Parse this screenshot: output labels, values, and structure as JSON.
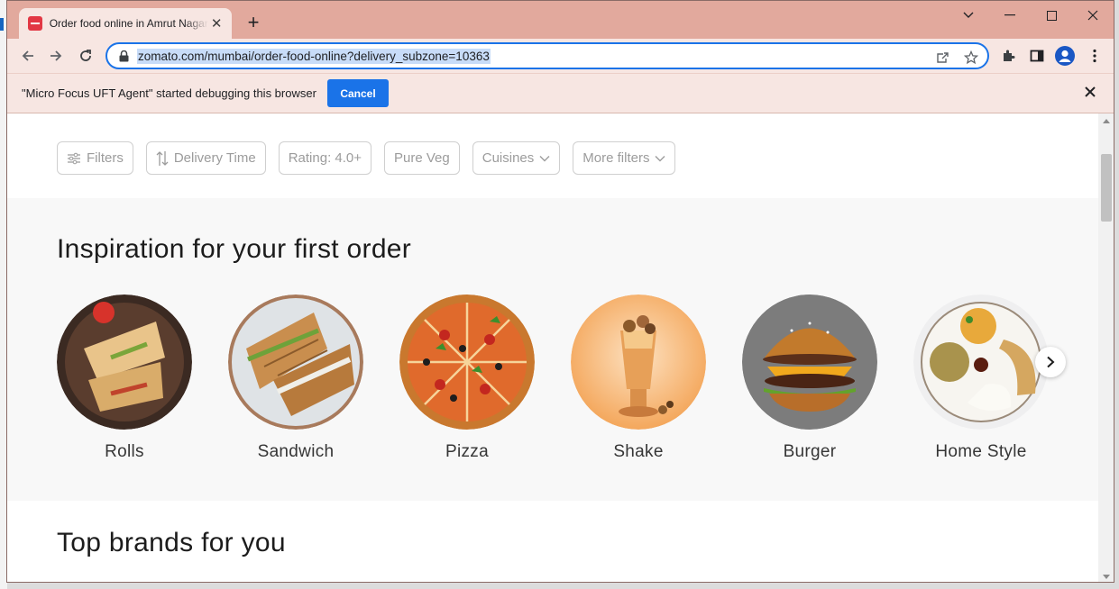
{
  "browser": {
    "tab_title": "Order food online in Amrut Nagar",
    "new_tab": "+",
    "url": "zomato.com/mumbai/order-food-online?delivery_subzone=10363"
  },
  "infobar": {
    "message": "\"Micro Focus UFT Agent\" started debugging this browser",
    "cancel_label": "Cancel"
  },
  "filters": [
    {
      "label": "Filters",
      "icon": "sliders-icon"
    },
    {
      "label": "Delivery Time",
      "icon": "sort-arrows-icon"
    },
    {
      "label": "Rating: 4.0+"
    },
    {
      "label": "Pure Veg"
    },
    {
      "label": "Cuisines",
      "icon": "chevron-down-icon"
    },
    {
      "label": "More filters",
      "icon": "chevron-down-icon"
    }
  ],
  "inspiration": {
    "title": "Inspiration for your first order",
    "items": [
      {
        "label": "Rolls",
        "color": "#8a5a2b"
      },
      {
        "label": "Sandwich",
        "color": "#c99a5b"
      },
      {
        "label": "Pizza",
        "color": "#d86a2a"
      },
      {
        "label": "Shake",
        "color": "#f2a65a"
      },
      {
        "label": "Burger",
        "color": "#8b4a1f"
      },
      {
        "label": "Home Style",
        "color": "#e8d9b8"
      }
    ]
  },
  "brands": {
    "title": "Top brands for you"
  },
  "colors": {
    "accent": "#1a73e8",
    "tab_strip": "#e2a99d",
    "toolbar": "#f7e6e2"
  }
}
